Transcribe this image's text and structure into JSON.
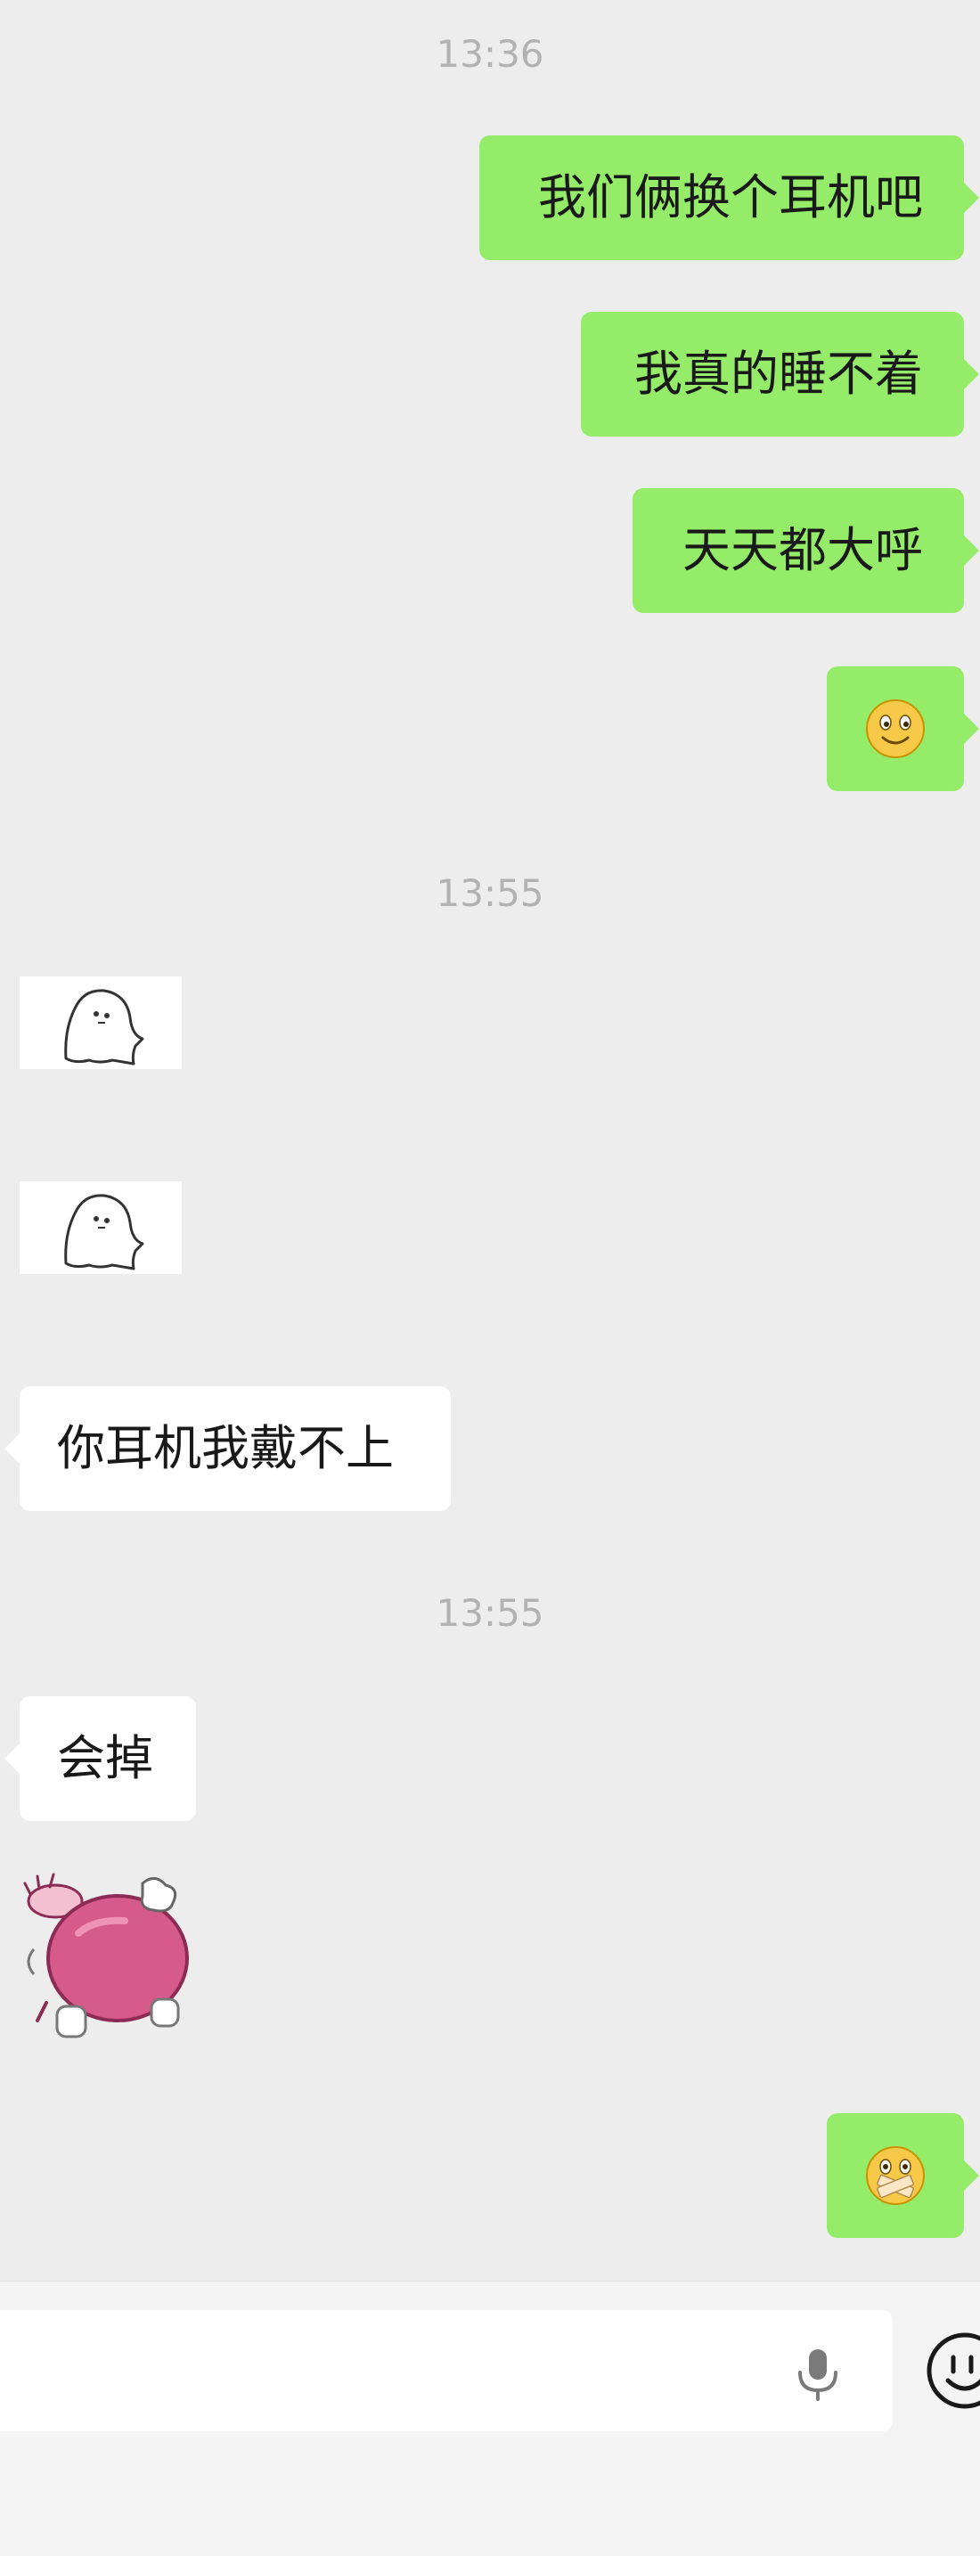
{
  "chat": {
    "timestamps": [
      "13:36",
      "13:55",
      "13:55"
    ],
    "messages": [
      {
        "direction": "outgoing",
        "type": "text",
        "text": "我们俩换个耳机吧"
      },
      {
        "direction": "outgoing",
        "type": "text",
        "text": "我真的睡不着"
      },
      {
        "direction": "outgoing",
        "type": "text",
        "text": "天天都大呼"
      },
      {
        "direction": "outgoing",
        "type": "emoji",
        "icon": "smiley-emoji-icon"
      },
      {
        "direction": "incoming",
        "type": "sticker",
        "icon": "ghost-sticker-icon"
      },
      {
        "direction": "incoming",
        "type": "sticker",
        "icon": "ghost-sticker-icon"
      },
      {
        "direction": "incoming",
        "type": "text",
        "text": "你耳机我戴不上"
      },
      {
        "direction": "incoming",
        "type": "text",
        "text": "会掉"
      },
      {
        "direction": "incoming",
        "type": "sticker",
        "icon": "pink-pig-sticker-icon"
      },
      {
        "direction": "outgoing",
        "type": "emoji",
        "icon": "mouth-taped-emoji-icon"
      }
    ]
  },
  "input_bar": {
    "icons": [
      "voice-mic-icon",
      "emoji-face-icon"
    ]
  },
  "colors": {
    "background": "#ededed",
    "outgoing_bubble": "#95ec69",
    "incoming_bubble": "#ffffff",
    "timestamp_text": "#b2b2b2"
  }
}
